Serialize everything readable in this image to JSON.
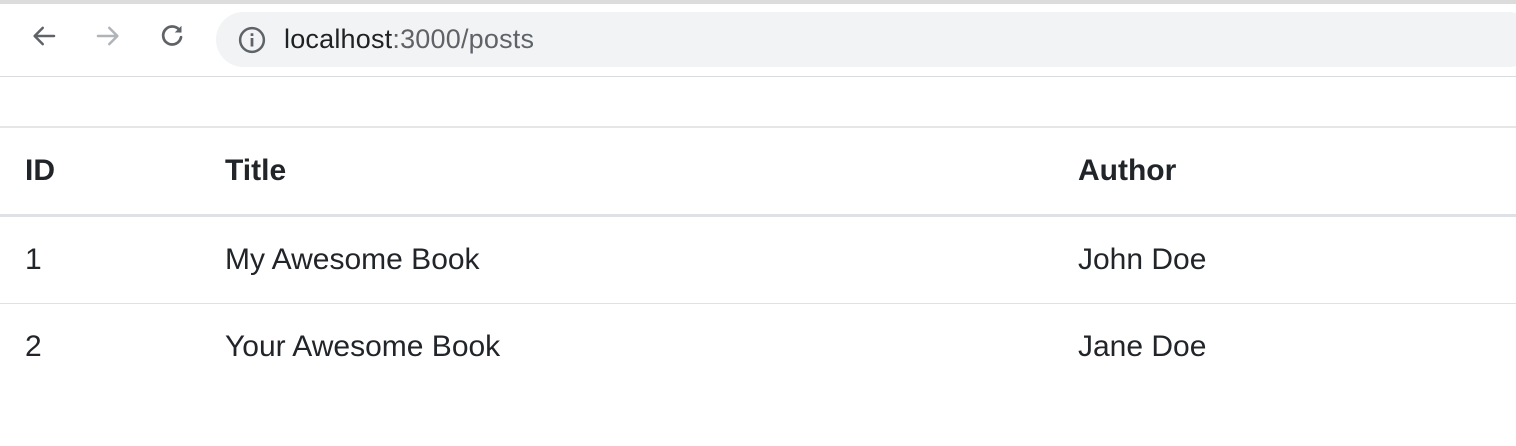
{
  "browser": {
    "url_host": "localhost",
    "url_rest": ":3000/posts",
    "icons": {
      "back": "arrow-left-icon",
      "forward": "arrow-right-icon",
      "reload": "reload-icon",
      "site_info": "info-icon"
    },
    "colors": {
      "omnibox_bg": "#f1f3f4",
      "forward_disabled": "#b0b3b8"
    }
  },
  "table": {
    "headers": [
      "ID",
      "Title",
      "Author"
    ],
    "rows": [
      [
        "1",
        "My Awesome Book",
        "John Doe"
      ],
      [
        "2",
        "Your Awesome Book",
        "Jane Doe"
      ]
    ]
  }
}
